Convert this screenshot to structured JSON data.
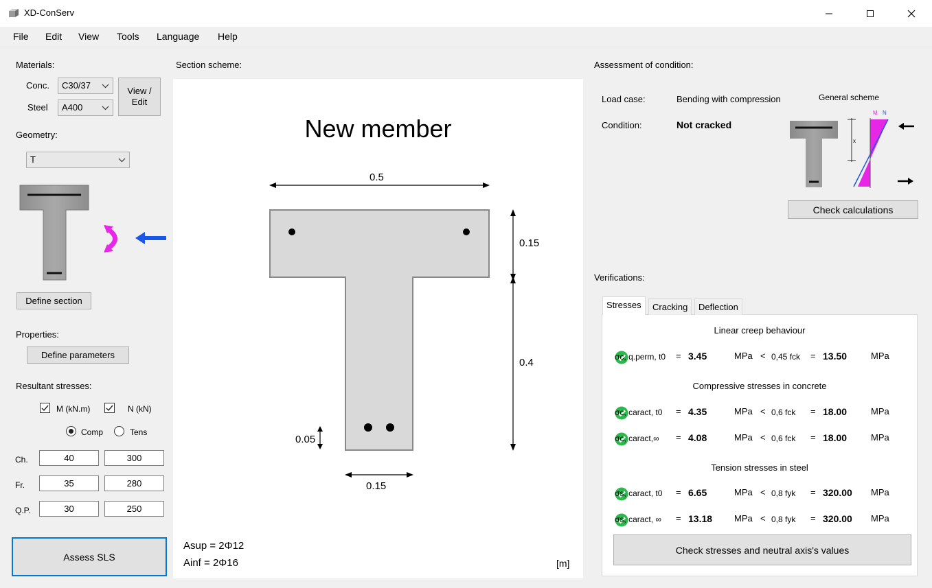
{
  "window": {
    "title": "XD-ConServ"
  },
  "menu": [
    "File",
    "Edit",
    "View",
    "Tools",
    "Language",
    "Help"
  ],
  "left": {
    "materials_label": "Materials:",
    "conc_label": "Conc.",
    "conc_value": "C30/37",
    "steel_label": "Steel",
    "steel_value": "A400",
    "view_edit_button": "View / Edit",
    "geometry_label": "Geometry:",
    "geometry_value": "T",
    "define_section_button": "Define section",
    "properties_label": "Properties:",
    "define_parameters_button": "Define parameters",
    "resultant_label": "Resultant stresses:",
    "m_checkbox_label": "M (kN.m)",
    "n_checkbox_label": "N (kN)",
    "m_checked": true,
    "n_checked": true,
    "comp_label": "Comp",
    "tens_label": "Tens",
    "selected_mode": "Comp",
    "rows": [
      {
        "label": "Ch.",
        "m": "40",
        "n": "300"
      },
      {
        "label": "Fr.",
        "m": "35",
        "n": "280"
      },
      {
        "label": "Q.P.",
        "m": "30",
        "n": "250"
      }
    ],
    "assess_button": "Assess SLS"
  },
  "scheme": {
    "label": "Section scheme:",
    "member_name": "New member",
    "dim_top_width": "0.5",
    "dim_flange_height": "0.15",
    "dim_web_height": "0.4",
    "dim_cover": "0.05",
    "dim_web_width": "0.15",
    "asup": "Asup = 2Φ12",
    "ainf": "Ainf = 2Φ16",
    "units": "[m]"
  },
  "assessment": {
    "label": "Assessment of condition:",
    "load_case_label": "Load case:",
    "load_case_value": "Bending with compression",
    "condition_label": "Condition:",
    "condition_value": "Not cracked",
    "general_scheme_label": "General scheme",
    "diagram_m": "M",
    "diagram_n": "N",
    "diagram_x": "x",
    "check_calculations_button": "Check calculations"
  },
  "verifications": {
    "label": "Verifications:",
    "tabs": [
      "Stresses",
      "Cracking",
      "Deflection"
    ],
    "active_tab": "Stresses",
    "section_linear": "Linear creep behaviour",
    "section_compressive": "Compressive stresses in concrete",
    "section_tension": "Tension stresses in steel",
    "rows": [
      {
        "symbol": "σc, q.perm, t0",
        "eq": "=",
        "value": "3.45",
        "unit": "MPa",
        "op": "<",
        "limit_label": "0,45 fck",
        "eq2": "=",
        "limit_value": "13.50",
        "unit2": "MPa"
      },
      {
        "symbol": "σc, caract, t0",
        "eq": "=",
        "value": "4.35",
        "unit": "MPa",
        "op": "<",
        "limit_label": "0,6 fck",
        "eq2": "=",
        "limit_value": "18.00",
        "unit2": "MPa"
      },
      {
        "symbol": "σc, caract,∞",
        "eq": "=",
        "value": "4.08",
        "unit": "MPa",
        "op": "<",
        "limit_label": "0,6 fck",
        "eq2": "=",
        "limit_value": "18.00",
        "unit2": "MPa"
      },
      {
        "symbol": "σs, caract, t0",
        "eq": "=",
        "value": "6.65",
        "unit": "MPa",
        "op": "<",
        "limit_label": "0,8 fyk",
        "eq2": "=",
        "limit_value": "320.00",
        "unit2": "MPa"
      },
      {
        "symbol": "σs, caract, ∞",
        "eq": "=",
        "value": "13.18",
        "unit": "MPa",
        "op": "<",
        "limit_label": "0,8 fyk",
        "eq2": "=",
        "limit_value": "320.00",
        "unit2": "MPa"
      }
    ],
    "check_stresses_button": "Check stresses and neutral axis's values"
  },
  "colors": {
    "accent": "#0078d7",
    "ok": "#2db84d",
    "moment": "#e628e6",
    "axial": "#1a56e8"
  }
}
